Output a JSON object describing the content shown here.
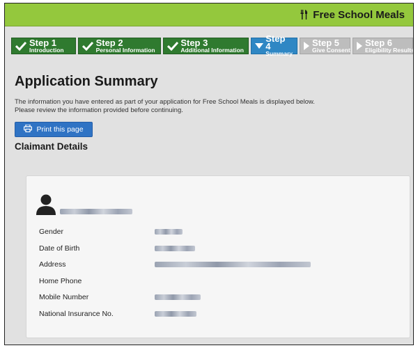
{
  "header": {
    "app_title": "Free School Meals",
    "app_icon": "cutlery-icon",
    "accent": "#94c83d"
  },
  "steps": [
    {
      "number": "Step 1",
      "label": "Introduction",
      "state": "done"
    },
    {
      "number": "Step 2",
      "label": "Personal Information",
      "state": "done"
    },
    {
      "number": "Step 3",
      "label": "Additional Information",
      "state": "done"
    },
    {
      "number": "Step 4",
      "label": "Summary",
      "state": "active"
    },
    {
      "number": "Step 5",
      "label": "Give Consent",
      "state": "todo"
    },
    {
      "number": "Step 6",
      "label": "Eligibility Results",
      "state": "todo"
    }
  ],
  "page": {
    "title": "Application Summary",
    "intro_line1": "The information you have entered as part of your application for Free School Meals is displayed below.",
    "intro_line2": "Please review the information provided before continuing.",
    "print_label": "Print this page",
    "section_title": "Claimant Details"
  },
  "claimant": {
    "fields": [
      {
        "label": "Gender"
      },
      {
        "label": "Date of Birth"
      },
      {
        "label": "Address"
      },
      {
        "label": "Home Phone"
      },
      {
        "label": "Mobile Number"
      },
      {
        "label": "National Insurance No."
      }
    ]
  }
}
